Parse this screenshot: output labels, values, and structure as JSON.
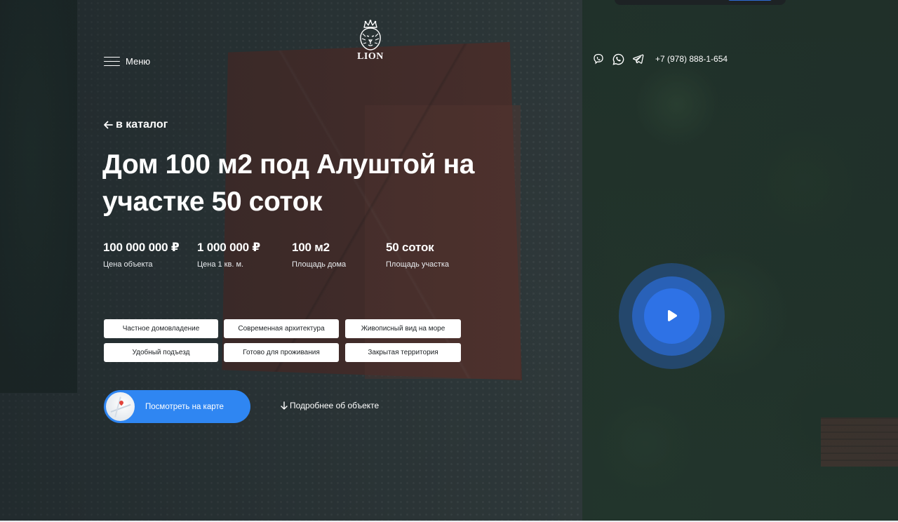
{
  "header": {
    "menu_label": "Меню",
    "logo_text": "LION",
    "phone": "+7 (978) 888-1-654",
    "messengers": [
      {
        "name": "viber-icon"
      },
      {
        "name": "whatsapp-icon"
      },
      {
        "name": "telegram-icon"
      }
    ]
  },
  "property": {
    "back_label": "в каталог",
    "title": "Дом 100 м2 под Алуштой на участке 50 соток",
    "stats": [
      {
        "value": "100 000 000 ₽",
        "label": "Цена объекта"
      },
      {
        "value": "1 000 000 ₽",
        "label": "Цена 1 кв. м."
      },
      {
        "value": "100 м2",
        "label": "Площадь дома"
      },
      {
        "value": "50 соток",
        "label": "Площадь участка"
      }
    ],
    "tags": [
      "Частное домовладение",
      "Современная архитектура",
      "Живописный вид на море",
      "Удобный подъезд",
      "Готово для проживания",
      "Закрытая территория"
    ],
    "map_button_label": "Посмотреть на карте",
    "details_label": "Подробнее об объекте"
  },
  "colors": {
    "accent": "#2f86f2",
    "play_button": "#2e72e6",
    "tag_bg": "#ffffff",
    "tag_text": "#1b1f22"
  }
}
